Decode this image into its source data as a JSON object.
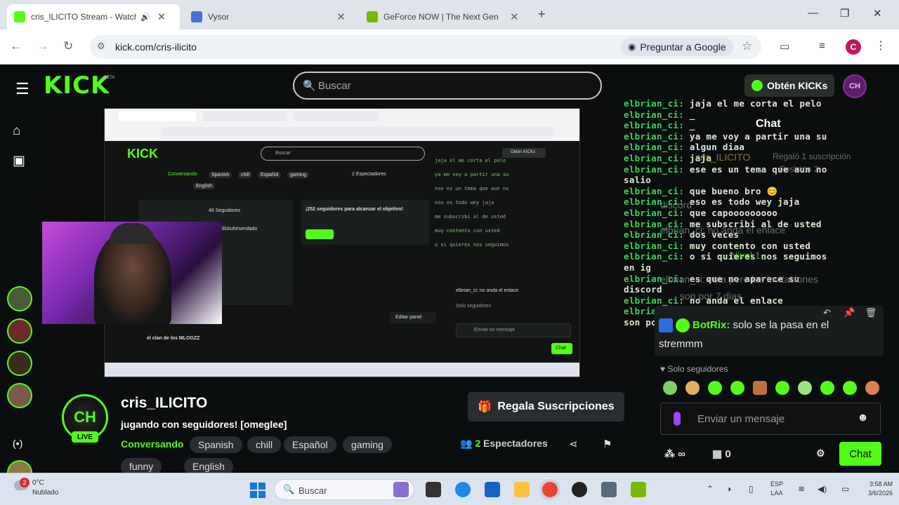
{
  "browser": {
    "tabs": [
      {
        "title": "cris_ILICITO Stream - Watch",
        "active": true,
        "favicon_color": "#53fc18"
      },
      {
        "title": "Vysor",
        "active": false,
        "favicon_color": "#4a6fd1"
      },
      {
        "title": "GeForce NOW | The Next Gen",
        "active": false,
        "favicon_color": "#76b900"
      }
    ],
    "url": "kick.com/cris-ilicito",
    "google_pill": "Preguntar a Google",
    "profile_initial": "C"
  },
  "kick": {
    "logo": "KICK",
    "beta": "BETA",
    "search_placeholder": "Buscar",
    "get_kicks": "Obtén KICKs",
    "chat_title": "Chat",
    "overlay_chat": [
      {
        "user": "elbrian_ci:",
        "msg": "jaja el me corta el pelo"
      },
      {
        "user": "elbrian_ci:",
        "msg": "_"
      },
      {
        "user": "elbrian_ci:",
        "msg": "_"
      },
      {
        "user": "elbrian_ci:",
        "msg": "ya me voy a partir una su"
      },
      {
        "user": "elbrian_ci:",
        "msg": "algun diaa"
      },
      {
        "user": "elbrian_ci:",
        "msg": "jaja"
      },
      {
        "user": "elbrian_ci:",
        "msg": "ese es un tema que aun no"
      },
      {
        "user": "",
        "msg": "salio"
      },
      {
        "user": "elbrian_ci:",
        "msg": "que bueno bro 😊"
      },
      {
        "user": "elbrian_ci:",
        "msg": "eso es todo wey jaja"
      },
      {
        "user": "elbrian_ci:",
        "msg": "que capooooooooo"
      },
      {
        "user": "elbrian_ci:",
        "msg": "me subscribi al de usted"
      },
      {
        "user": "elbrian_ci:",
        "msg": "dos veces"
      },
      {
        "user": "elbrian_ci:",
        "msg": "muy contento con usted"
      },
      {
        "user": "elbrian_ci:",
        "msg": "o si quieres nos seguimos"
      },
      {
        "user": "",
        "msg": "en ig"
      },
      {
        "user": "elbrian_ci:",
        "msg": "es que no aparece su"
      },
      {
        "user": "",
        "msg": "discord"
      },
      {
        "user": "elbrian_ci:",
        "msg": "no anda el enlace"
      },
      {
        "user": "elbrian_ci:",
        "msg": "esta pero las invitaciones"
      },
      {
        "user": "",
        "msg": "son por 7 dias"
      }
    ],
    "ghost_chat": [
      "cris_ILICITO",
      "Regaló 1 suscripción",
      "Posición 2",
      "discord",
      "elbrian_ci: no anda el enlace",
      "Nivel 1",
      "elbrian_ci: esta pero las invitaciones",
      "son por 7 dias"
    ],
    "pinned": {
      "user": "BotRix:",
      "text": "solo se la pasa en el stremmm"
    },
    "followers_only": "Solo seguidores",
    "message_placeholder": "Enviar un mensaje",
    "infinity": "∞",
    "kicks_count": "0",
    "chat_button": "Chat",
    "channel": {
      "avatar_text": "CH",
      "name": "cris_ILICITO",
      "live": "LIVE",
      "title": "jugando con seguidores! [omeglee]",
      "category": "Conversando",
      "tags": [
        "Spanish",
        "chill",
        "Español",
        "gaming",
        "funny",
        "English"
      ],
      "gift_button": "Regala Suscripciones",
      "viewers": "2",
      "viewers_label": "Espectadores"
    },
    "inner_screen": {
      "search": "Buscar",
      "goal": "¡252 seguidores para alcanzar el objetivo!",
      "followers": "46 Seguidores",
      "instagram": "@lilckuhesendado",
      "clan": "el clan de los MLOGZZ",
      "edit_panel": "Editar panel",
      "send_message": "Enviar un mensaje",
      "chat_button": "Chat",
      "viewers": "2 Espectadores",
      "talking": "Conversando",
      "tags": [
        "Spanish",
        "chill",
        "Español",
        "gaming"
      ],
      "tag_row2": "English",
      "kicks_button": "Obtén KICKs",
      "follower_only": "Solo seguidores",
      "link_text": "elbrian_ci: no anda el enlace"
    }
  },
  "taskbar": {
    "weather_temp": "0°C",
    "weather_desc": "Nublado",
    "notif_count": "2",
    "search_placeholder": "Buscar",
    "lang_top": "ESP",
    "lang_bottom": "LAA",
    "time": "3:58 AM",
    "date": "3/6/2026"
  }
}
